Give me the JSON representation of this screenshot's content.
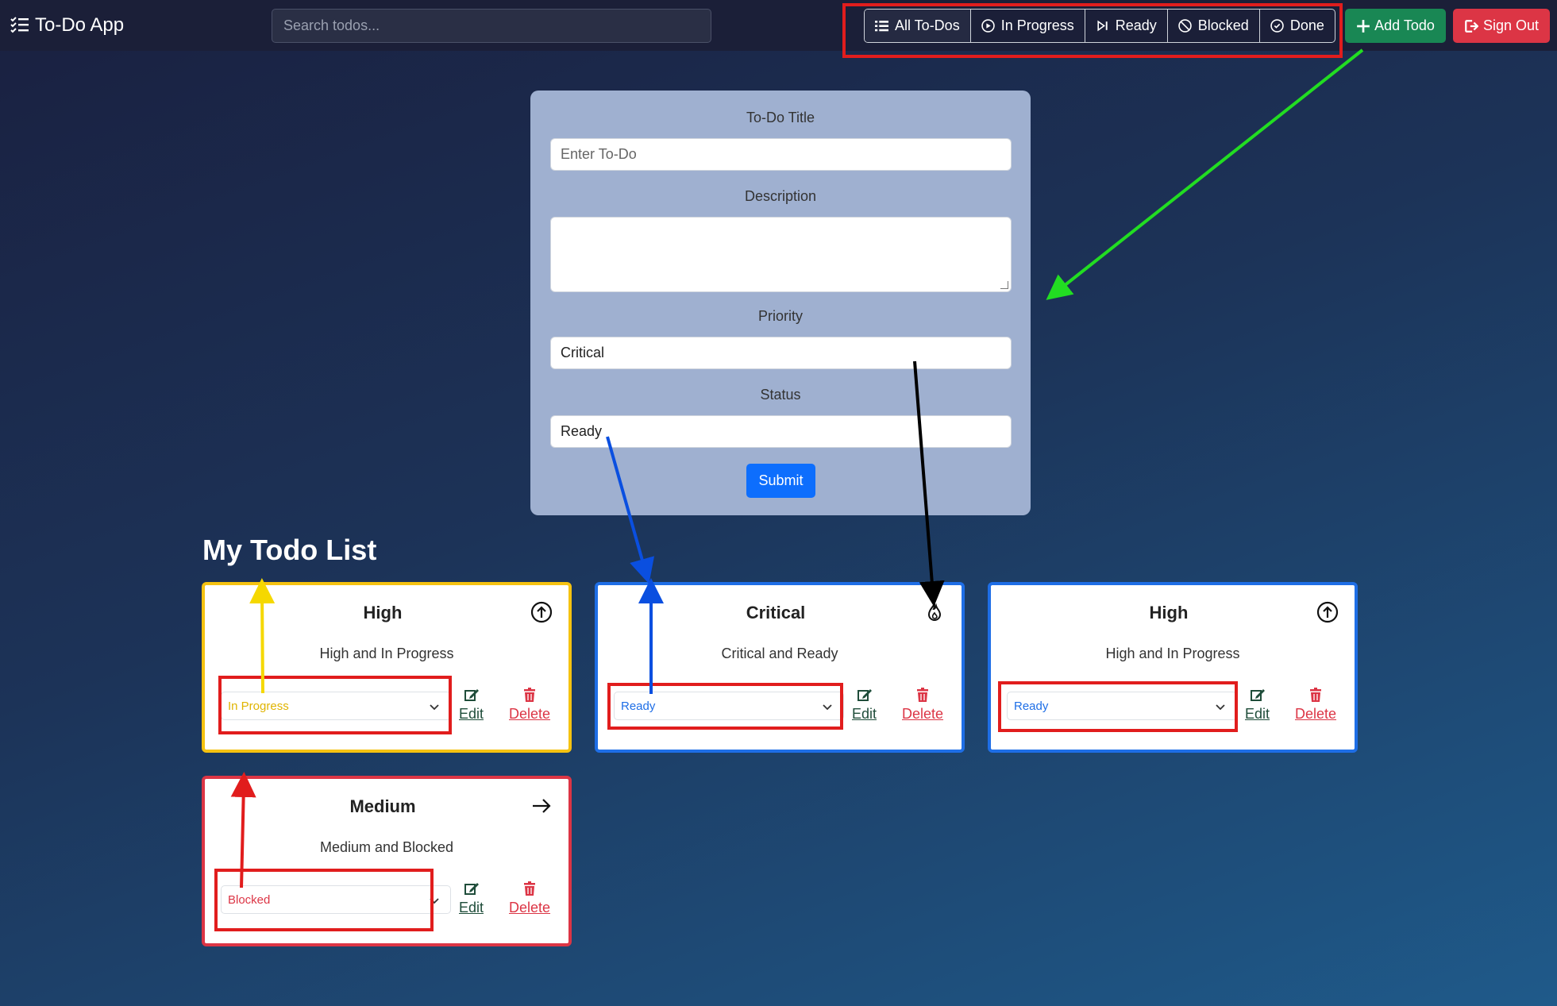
{
  "navbar": {
    "brand": "To-Do App",
    "search_placeholder": "Search todos...",
    "filters": [
      {
        "label": "All To-Dos",
        "icon": "list-icon"
      },
      {
        "label": "In Progress",
        "icon": "play-circle-icon"
      },
      {
        "label": "Ready",
        "icon": "skip-end-icon"
      },
      {
        "label": "Blocked",
        "icon": "slash-circle-icon"
      },
      {
        "label": "Done",
        "icon": "check-circle-icon"
      }
    ],
    "add_label": "Add Todo",
    "signout_label": "Sign Out"
  },
  "form": {
    "title_label": "To-Do Title",
    "title_placeholder": "Enter To-Do",
    "description_label": "Description",
    "description_value": "",
    "priority_label": "Priority",
    "priority_value": "Critical",
    "status_label": "Status",
    "status_value": "Ready",
    "submit_label": "Submit"
  },
  "list": {
    "title": "My Todo List",
    "edit_label": "Edit",
    "delete_label": "Delete",
    "cards": [
      {
        "priority": "High",
        "description": "High and In Progress",
        "status": "In Progress",
        "icon": "arrow-up-circle-icon",
        "border_color": "#f5c211",
        "status_color": "#e0b400"
      },
      {
        "priority": "Critical",
        "description": "Critical and Ready",
        "status": "Ready",
        "icon": "fire-icon",
        "border_color": "#1e6ee6",
        "status_color": "#1e6ee6"
      },
      {
        "priority": "High",
        "description": "High and In Progress",
        "status": "Ready",
        "icon": "arrow-up-circle-icon",
        "border_color": "#1e6ee6",
        "status_color": "#1e6ee6"
      },
      {
        "priority": "Medium",
        "description": "Medium and Blocked",
        "status": "Blocked",
        "icon": "arrow-right-icon",
        "border_color": "#dc3545",
        "status_color": "#dc3545"
      }
    ]
  },
  "colors": {
    "navbar_bg": "#1b1f38",
    "add_button": "#198754",
    "signout_button": "#dc3545",
    "submit_button": "#0d6efd",
    "annotation_red": "#e11d1d",
    "annotation_green": "#22dd22",
    "annotation_blue": "#0a4fe0",
    "annotation_yellow": "#f5d800",
    "annotation_black": "#000000"
  }
}
